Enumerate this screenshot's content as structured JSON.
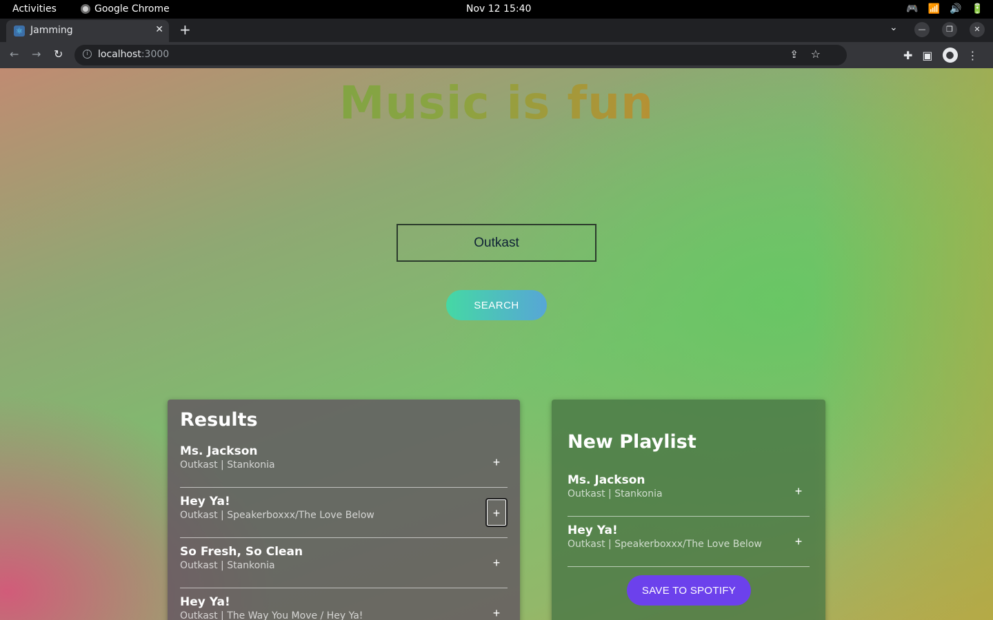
{
  "system_bar": {
    "activities": "Activities",
    "app_name": "Google Chrome",
    "clock": "Nov 12  15:40"
  },
  "browser": {
    "tab_title": "Jamming",
    "url_host": "localhost",
    "url_port": ":3000"
  },
  "app": {
    "headline": "Music is fun",
    "search": {
      "value": "Outkast",
      "placeholder": "",
      "button_label": "SEARCH"
    },
    "results": {
      "title": "Results",
      "tracks": [
        {
          "name": "Ms. Jackson",
          "info": "Outkast | Stankonia",
          "action": "+"
        },
        {
          "name": "Hey Ya!",
          "info": "Outkast | Speakerboxxx/The Love Below",
          "action": "+"
        },
        {
          "name": "So Fresh, So Clean",
          "info": "Outkast | Stankonia",
          "action": "+"
        },
        {
          "name": "Hey Ya!",
          "info": "Outkast | The Way You Move / Hey Ya!",
          "action": "+"
        }
      ]
    },
    "playlist": {
      "title": "New Playlist",
      "tracks": [
        {
          "name": "Ms. Jackson",
          "info": "Outkast | Stankonia",
          "action": "+"
        },
        {
          "name": "Hey Ya!",
          "info": "Outkast | Speakerboxxx/The Love Below",
          "action": "+"
        }
      ],
      "save_label": "SAVE TO SPOTIFY"
    }
  },
  "colors": {
    "save_button": "#6c41ec",
    "search_button_start": "#45d8a4",
    "search_button_end": "#57a6d6"
  }
}
